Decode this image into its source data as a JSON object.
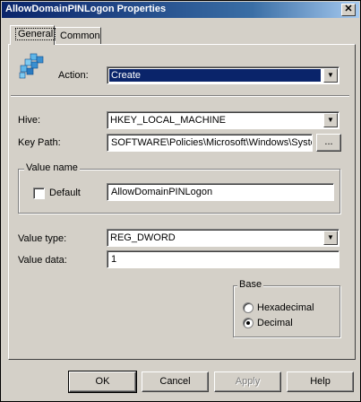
{
  "window": {
    "title": "AllowDomainPINLogon Properties",
    "close_glyph": "✕"
  },
  "tabs": [
    {
      "label": "General"
    },
    {
      "label": "Common"
    }
  ],
  "general": {
    "action_label": "Action:",
    "action_value": "Create",
    "hive_label": "Hive:",
    "hive_value": "HKEY_LOCAL_MACHINE",
    "key_path_label": "Key Path:",
    "key_path_value": "SOFTWARE\\Policies\\Microsoft\\Windows\\Syster",
    "browse_label": "...",
    "value_name_group": "Value name",
    "default_label": "Default",
    "default_checked": false,
    "value_name_value": "AllowDomainPINLogon",
    "value_type_label": "Value type:",
    "value_type_value": "REG_DWORD",
    "value_data_label": "Value data:",
    "value_data_value": "1",
    "base_group": "Base",
    "hex_label": "Hexadecimal",
    "decimal_label": "Decimal",
    "selected_base": "Decimal"
  },
  "buttons": {
    "ok": "OK",
    "cancel": "Cancel",
    "apply": "Apply",
    "help": "Help"
  },
  "icons": {
    "registry": "registry-cubes-icon",
    "dropdown": "chevron-down-icon"
  },
  "colors": {
    "titlebar": "#0a246a",
    "face": "#d4d0c8",
    "selection": "#0a246a"
  }
}
